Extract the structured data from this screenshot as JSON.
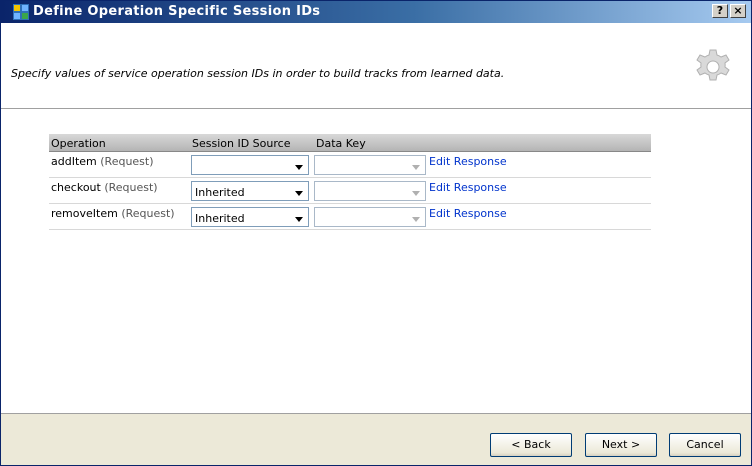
{
  "window": {
    "title": "Define Operation Specific Session IDs",
    "help_label": "?",
    "close_label": "×"
  },
  "header": {
    "instructions": "Specify values of service operation session IDs in order to build tracks from learned data.",
    "icon": "gear-icon"
  },
  "grid": {
    "columns": [
      "Operation",
      "Session ID Source",
      "Data Key"
    ],
    "rows": [
      {
        "operation": "addItem",
        "type": "(Request)",
        "session_id_source": "",
        "data_key": "",
        "link": "Edit Response"
      },
      {
        "operation": "checkout",
        "type": "(Request)",
        "session_id_source": "Inherited",
        "data_key": "",
        "link": "Edit Response"
      },
      {
        "operation": "removeItem",
        "type": "(Request)",
        "session_id_source": "Inherited",
        "data_key": "",
        "link": "Edit Response"
      }
    ]
  },
  "footer": {
    "back_label": "< Back",
    "next_label": "Next >",
    "cancel_label": "Cancel"
  },
  "colors": {
    "titlebar_start": "#0a246a",
    "titlebar_end": "#a6caf0",
    "link": "#0033cc",
    "footer_bg": "#ece9d8"
  }
}
